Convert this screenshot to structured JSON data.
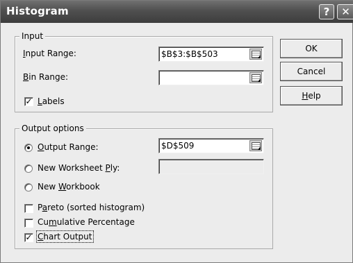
{
  "dialog": {
    "title": "Histogram",
    "title_help_glyph": "?",
    "close_glyph": "✕"
  },
  "input_group": {
    "legend": "Input",
    "input_range_label": {
      "access": "I",
      "rest": "nput Range:"
    },
    "input_range_value": "$B$3:$B$503",
    "bin_range_label": {
      "access": "B",
      "rest": "in Range:"
    },
    "bin_range_value": "",
    "labels_checkbox": {
      "access": "L",
      "rest": "abels",
      "checked": true
    }
  },
  "output_group": {
    "legend": "Output options",
    "output_range": {
      "access": "O",
      "rest": "utput Range:",
      "selected": true,
      "value": "$D$509"
    },
    "new_worksheet_ply": {
      "before": "New Worksheet ",
      "access": "P",
      "after": "ly:",
      "selected": false,
      "value": ""
    },
    "new_workbook": {
      "before": "New ",
      "access": "W",
      "after": "orkbook",
      "selected": false
    },
    "pareto": {
      "before": "P",
      "access": "a",
      "after": "reto (sorted histogram)",
      "checked": false
    },
    "cumulative": {
      "before": "Cu",
      "access": "m",
      "after": "ulative Percentage",
      "checked": false
    },
    "chart_output": {
      "access": "C",
      "after": "hart Output",
      "checked": true
    }
  },
  "buttons": {
    "ok": "OK",
    "cancel": "Cancel",
    "help": {
      "access": "H",
      "rest": "elp"
    }
  },
  "icons": {
    "ref_button_icon": "collapse-dialog-icon",
    "check_glyph": "✓"
  }
}
